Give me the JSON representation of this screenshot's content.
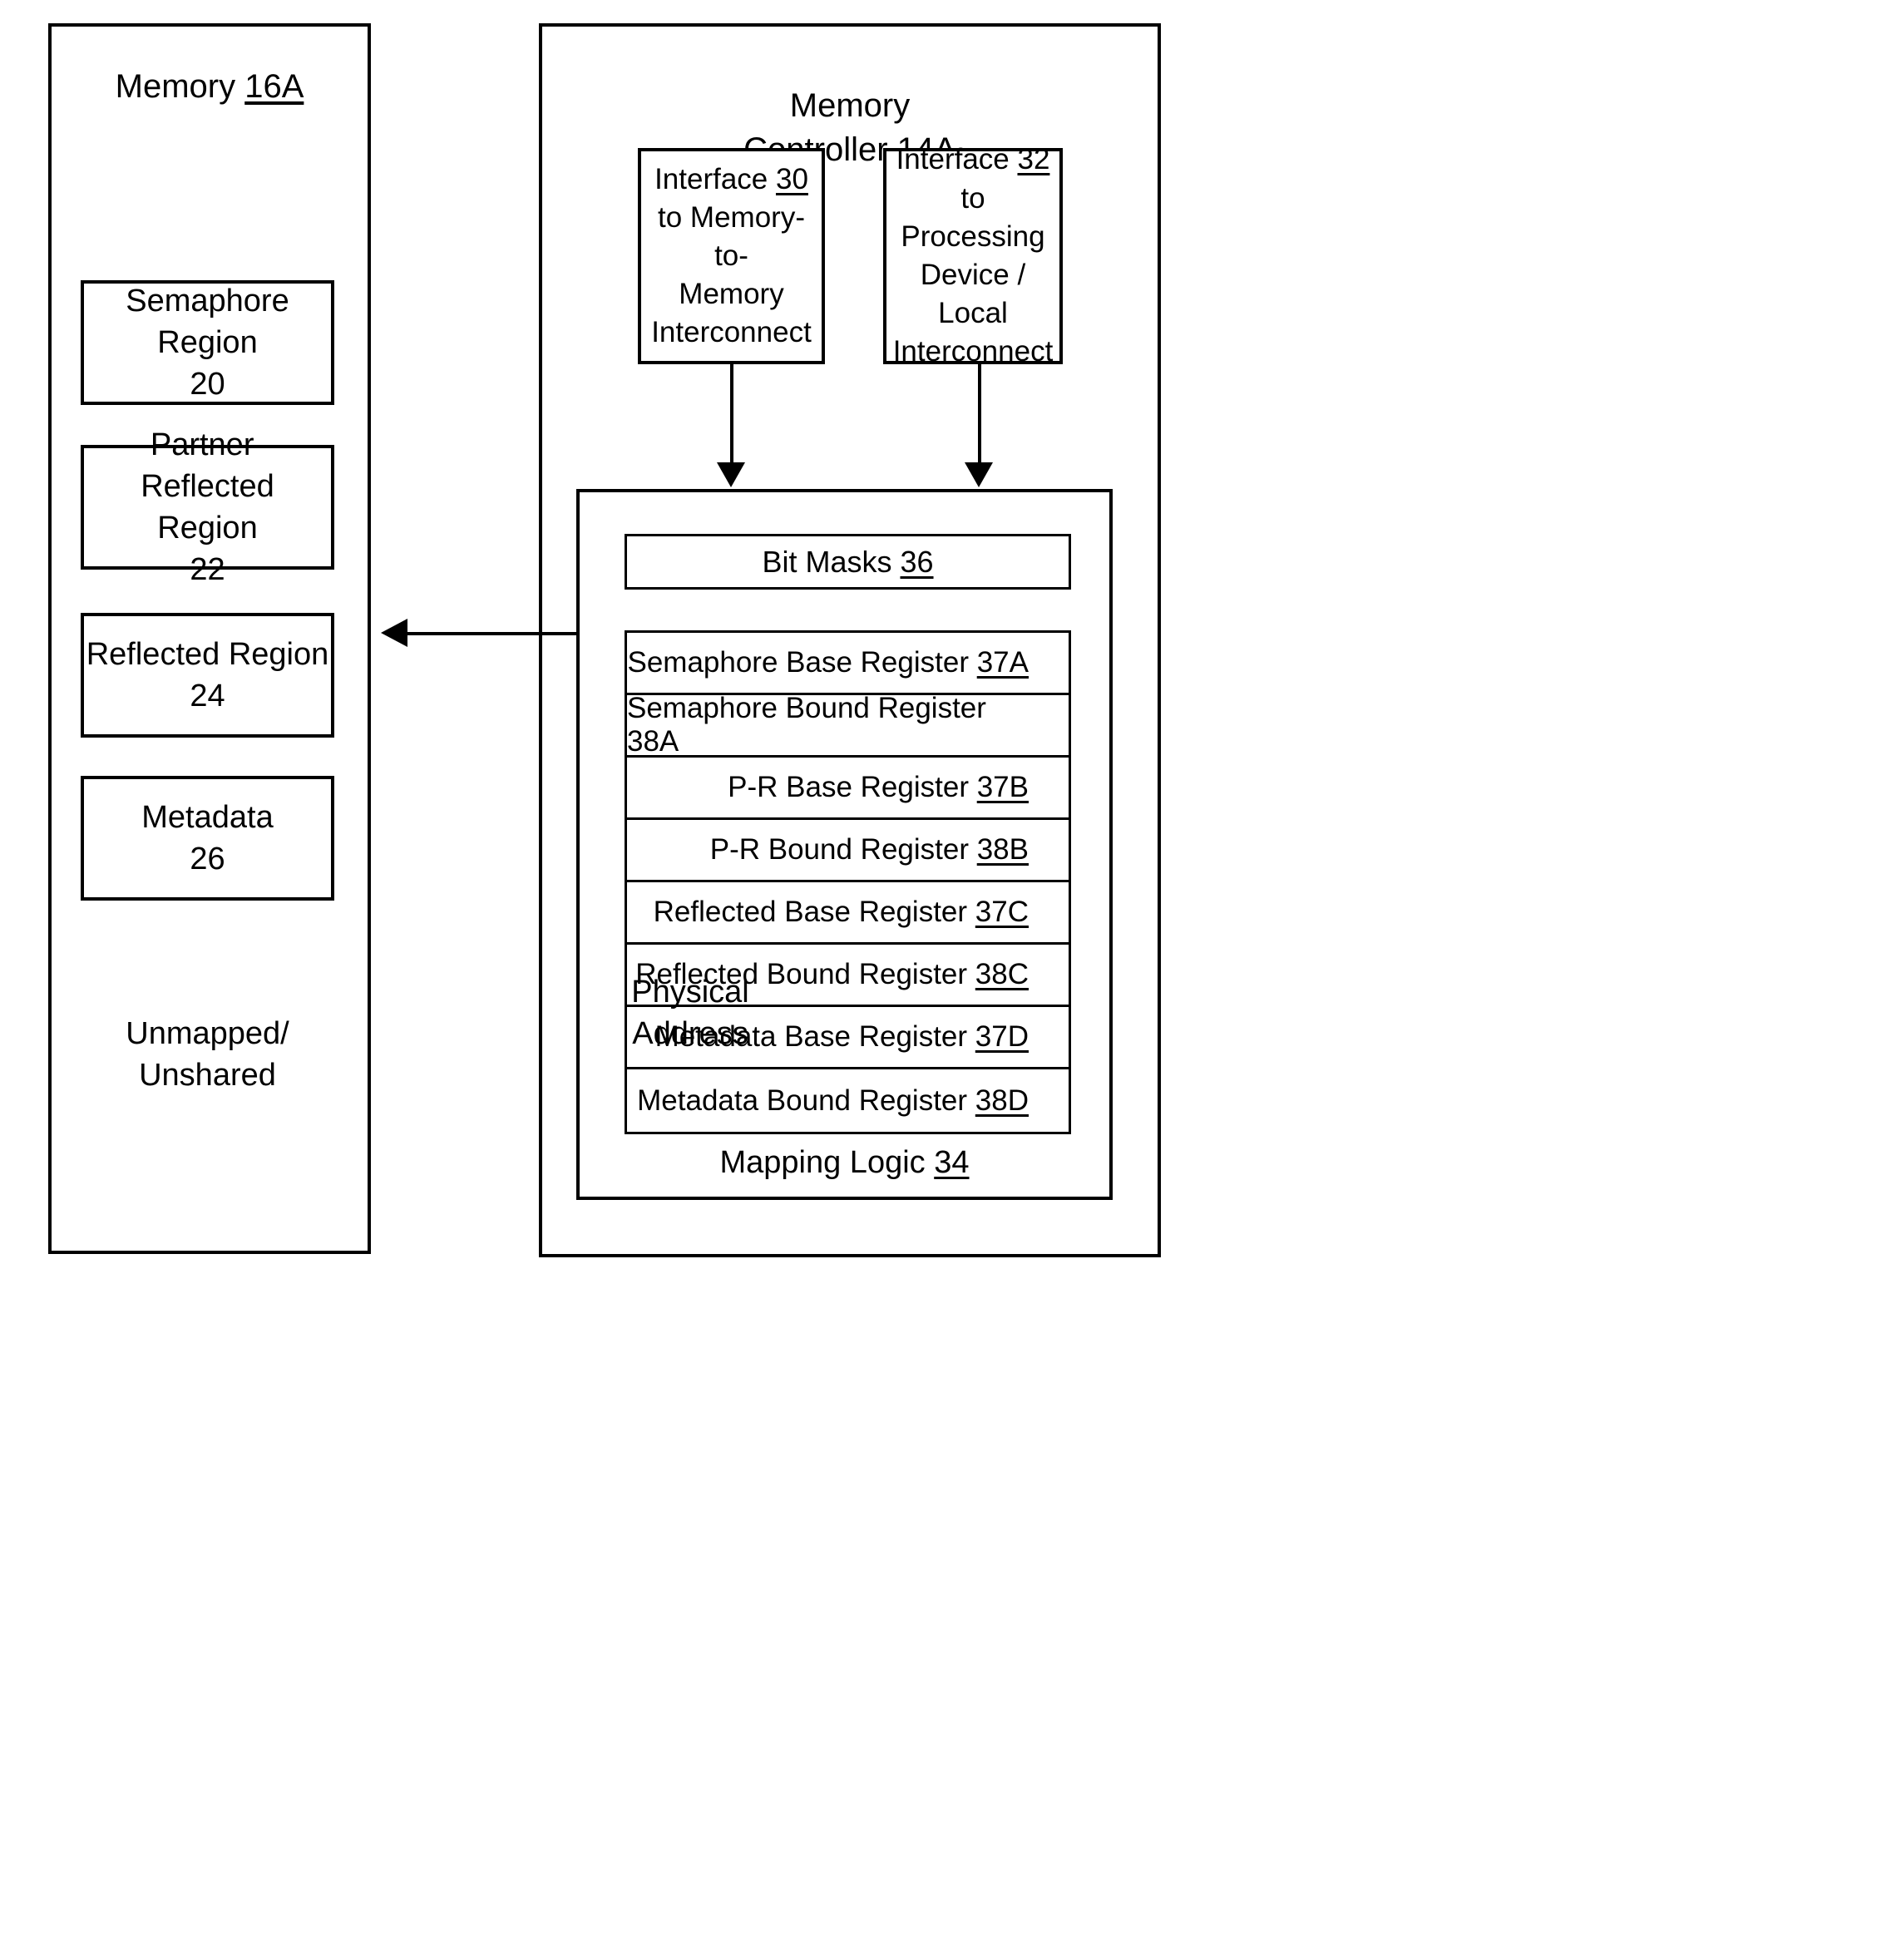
{
  "memory": {
    "title_text": "Memory ",
    "title_ref": "16A",
    "regions": [
      {
        "name": "Semaphore Region",
        "ref": "20"
      },
      {
        "name": "Partner-Reflected\nRegion",
        "ref": "22"
      },
      {
        "name": "Reflected Region",
        "ref": "24"
      },
      {
        "name": "Metadata",
        "ref": "26"
      }
    ],
    "unmapped_label": "Unmapped/\nUnshared"
  },
  "controller": {
    "title_line1": "Memory",
    "title_line2_text": "Controller ",
    "title_ref": "14A",
    "interfaces": [
      {
        "label_text": "Interface ",
        "ref": "30",
        "description": "to Memory-to-\nMemory\nInterconnect"
      },
      {
        "label_text": "Interface ",
        "ref": "32",
        "description": "to Processing\nDevice / Local\nInterconnect"
      }
    ],
    "bit_masks": {
      "label": "Bit Masks  ",
      "ref": "36"
    },
    "registers": [
      {
        "label": "Semaphore Base Register ",
        "ref": "37A"
      },
      {
        "label": "Semaphore Bound Register ",
        "ref": "38A"
      },
      {
        "label": "P-R Base Register ",
        "ref": "37B"
      },
      {
        "label": "P-R Bound Register ",
        "ref": "38B"
      },
      {
        "label": "Reflected Base Register ",
        "ref": "37C"
      },
      {
        "label": "Reflected Bound Register ",
        "ref": "38C"
      },
      {
        "label": "Metadata Base Register ",
        "ref": "37D"
      },
      {
        "label": "Metadata Bound Register ",
        "ref": "38D"
      }
    ],
    "mapping_logic": {
      "label": "Mapping Logic ",
      "ref": "34"
    }
  },
  "connectors": {
    "physical_address_label": "Physical\nAddress"
  },
  "colors": {
    "line": "#000000",
    "background": "#ffffff"
  }
}
